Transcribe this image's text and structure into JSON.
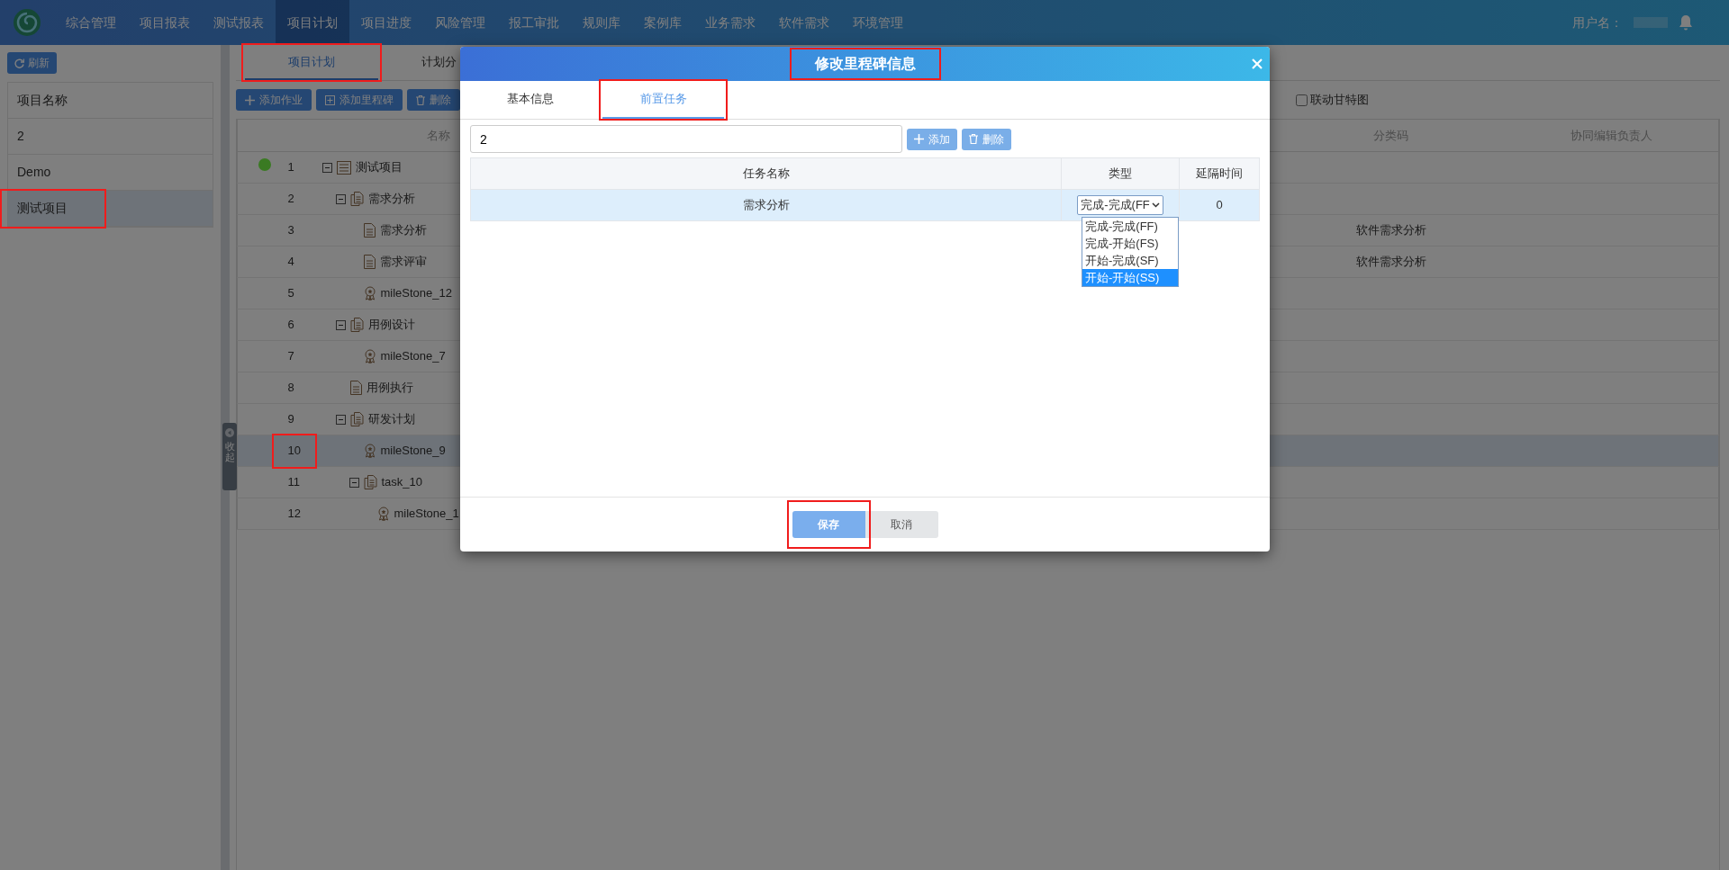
{
  "navbar": {
    "items": [
      {
        "label": "综合管理",
        "selected": false
      },
      {
        "label": "项目报表",
        "selected": false
      },
      {
        "label": "测试报表",
        "selected": false
      },
      {
        "label": "项目计划",
        "selected": true
      },
      {
        "label": "项目进度",
        "selected": false
      },
      {
        "label": "风险管理",
        "selected": false
      },
      {
        "label": "报工审批",
        "selected": false
      },
      {
        "label": "规则库",
        "selected": false
      },
      {
        "label": "案例库",
        "selected": false
      },
      {
        "label": "业务需求",
        "selected": false
      },
      {
        "label": "软件需求",
        "selected": false
      },
      {
        "label": "环境管理",
        "selected": false
      }
    ],
    "user_label": "用户名："
  },
  "sidebar": {
    "refresh_button": "刷新",
    "header": "项目名称",
    "items": [
      {
        "label": "2",
        "selected": false,
        "highlighted": false
      },
      {
        "label": "Demo",
        "selected": false,
        "highlighted": false
      },
      {
        "label": "测试项目",
        "selected": true,
        "highlighted": true
      }
    ]
  },
  "collapse_handle": "收起",
  "main": {
    "tabs": [
      {
        "label": "项目计划",
        "selected": true,
        "highlighted": true
      },
      {
        "label": "计划分",
        "selected": false,
        "highlighted": false
      }
    ],
    "toolbar": [
      {
        "label": "添加作业",
        "kind": "add"
      },
      {
        "label": "添加里程碑",
        "kind": "milestone"
      },
      {
        "label": "删除",
        "kind": "delete"
      }
    ],
    "gantt_option": {
      "label": "联动甘特图",
      "checked": false
    },
    "table": {
      "columns": [
        "名称",
        "分类码",
        "协同编辑负责人"
      ],
      "rows": [
        {
          "no": "1",
          "name": "测试项目",
          "kind": "plan",
          "expanded": true,
          "color": "#3a7a22",
          "selected": false,
          "highlighted": false,
          "children": [
            {
              "no": "2",
              "name": "需求分析",
              "kind": "group",
              "expanded": true,
              "selected": false,
              "highlighted": false,
              "children": [
                {
                  "no": "3",
                  "name": "需求分析",
                  "kind": "task",
                  "category": "软件需求分析",
                  "selected": false,
                  "highlighted": false
                },
                {
                  "no": "4",
                  "name": "需求评审",
                  "kind": "task",
                  "category": "软件需求分析",
                  "selected": false,
                  "highlighted": false
                },
                {
                  "no": "5",
                  "name": "mileStone_12",
                  "kind": "milestone",
                  "selected": false,
                  "highlighted": false
                }
              ]
            },
            {
              "no": "6",
              "name": "用例设计",
              "kind": "group",
              "expanded": true,
              "selected": false,
              "highlighted": false,
              "children": [
                {
                  "no": "7",
                  "name": "mileStone_7",
                  "kind": "milestone",
                  "selected": false,
                  "highlighted": false
                }
              ]
            },
            {
              "no": "8",
              "name": "用例执行",
              "kind": "task",
              "selected": false,
              "highlighted": false
            },
            {
              "no": "9",
              "name": "研发计划",
              "kind": "group",
              "expanded": true,
              "selected": false,
              "highlighted": false,
              "children": [
                {
                  "no": "10",
                  "name": "mileStone_9",
                  "kind": "milestone",
                  "selected": true,
                  "highlighted": true
                },
                {
                  "no": "11",
                  "name": "task_10",
                  "kind": "group",
                  "expanded": true,
                  "selected": false,
                  "highlighted": false,
                  "children": [
                    {
                      "no": "12",
                      "name": "mileStone_1",
                      "kind": "milestone",
                      "selected": false,
                      "highlighted": false
                    }
                  ]
                }
              ]
            }
          ]
        }
      ]
    }
  },
  "dialog": {
    "title": "修改里程碑信息",
    "title_highlighted": true,
    "tabs": [
      {
        "label": "基本信息",
        "selected": false,
        "highlighted": false
      },
      {
        "label": "前置任务",
        "selected": true,
        "highlighted": true
      }
    ],
    "task_input": {
      "value": "2"
    },
    "buttons": [
      {
        "label": "添加",
        "kind": "add"
      },
      {
        "label": "删除",
        "kind": "delete"
      }
    ],
    "table": {
      "columns": [
        "任务名称",
        "类型",
        "延隔时间"
      ],
      "rows": [
        {
          "name": "需求分析",
          "type": "完成-完成(FF",
          "delay": "0",
          "selected": true
        }
      ]
    },
    "type_dropdown": {
      "options": [
        {
          "label": "完成-完成(FF)",
          "hovered": false
        },
        {
          "label": "完成-开始(FS)",
          "hovered": false
        },
        {
          "label": "开始-完成(SF)",
          "hovered": false
        },
        {
          "label": "开始-开始(SS)",
          "hovered": true
        }
      ]
    },
    "footer": [
      {
        "label": "保存",
        "kind": "primary",
        "highlighted": true
      },
      {
        "label": "取消",
        "kind": "secondary",
        "highlighted": false
      }
    ]
  }
}
